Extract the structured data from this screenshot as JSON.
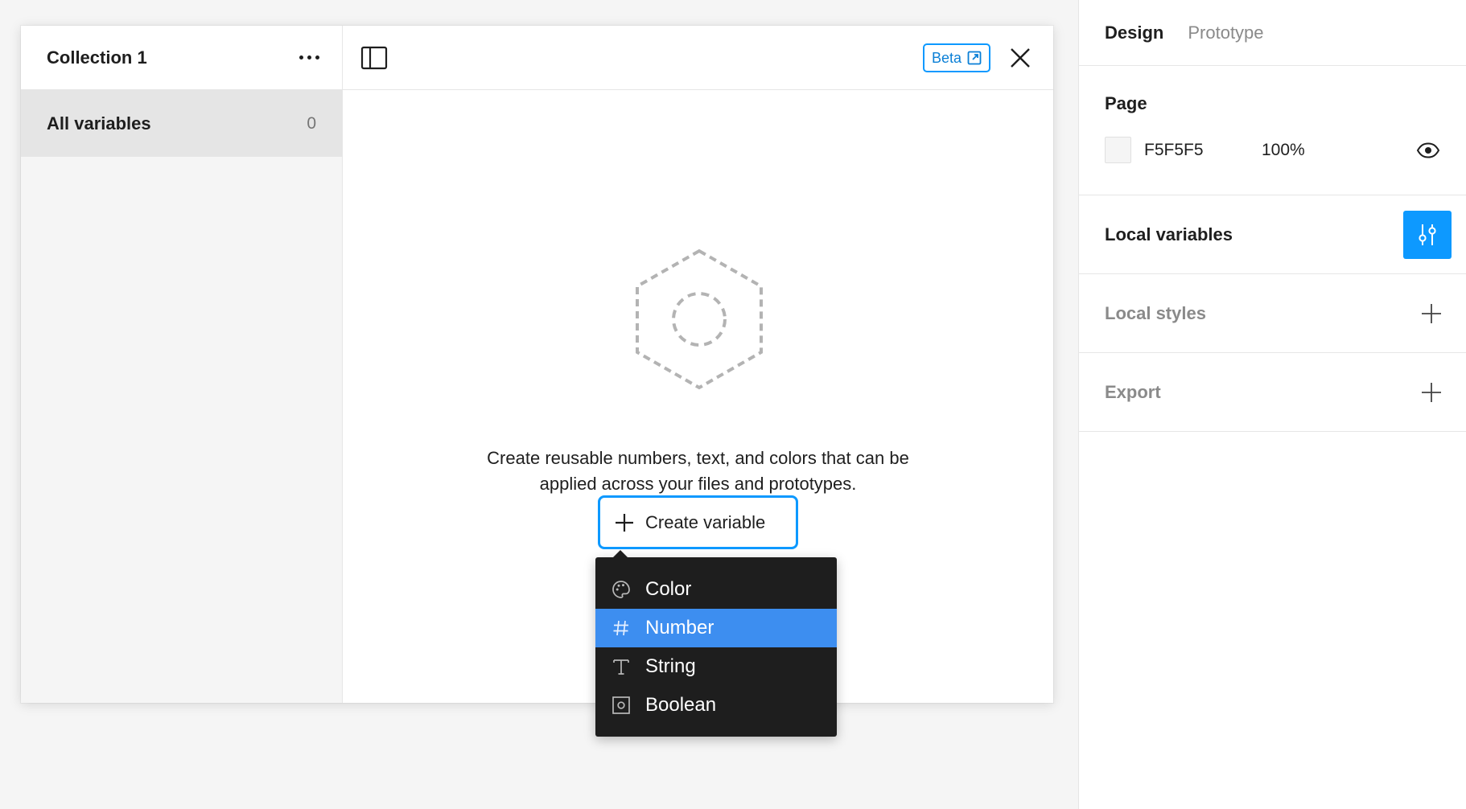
{
  "modal": {
    "collection_title": "Collection 1",
    "left_items": [
      {
        "label": "All variables",
        "count": "0"
      }
    ],
    "beta_label": "Beta",
    "empty_text_line1": "Create reusable numbers, text, and colors that can be",
    "empty_text_line2": "applied across your files and prototypes.",
    "create_button_label": "Create variable"
  },
  "dropdown": {
    "items": [
      {
        "label": "Color",
        "icon": "palette-icon",
        "active": false
      },
      {
        "label": "Number",
        "icon": "hash-icon",
        "active": true
      },
      {
        "label": "String",
        "icon": "text-t-icon",
        "active": false
      },
      {
        "label": "Boolean",
        "icon": "toggle-box-icon",
        "active": false
      }
    ]
  },
  "panel": {
    "tabs": [
      "Design",
      "Prototype"
    ],
    "active_tab": "Design",
    "page": {
      "title": "Page",
      "color_hex": "F5F5F5",
      "opacity": "100%"
    },
    "local_variables": "Local variables",
    "local_styles": "Local styles",
    "export": "Export"
  },
  "colors": {
    "accent": "#0d99ff",
    "menu_bg": "#1e1e1e",
    "menu_active": "#3d8ef0",
    "canvas": "#f5f5f5"
  }
}
